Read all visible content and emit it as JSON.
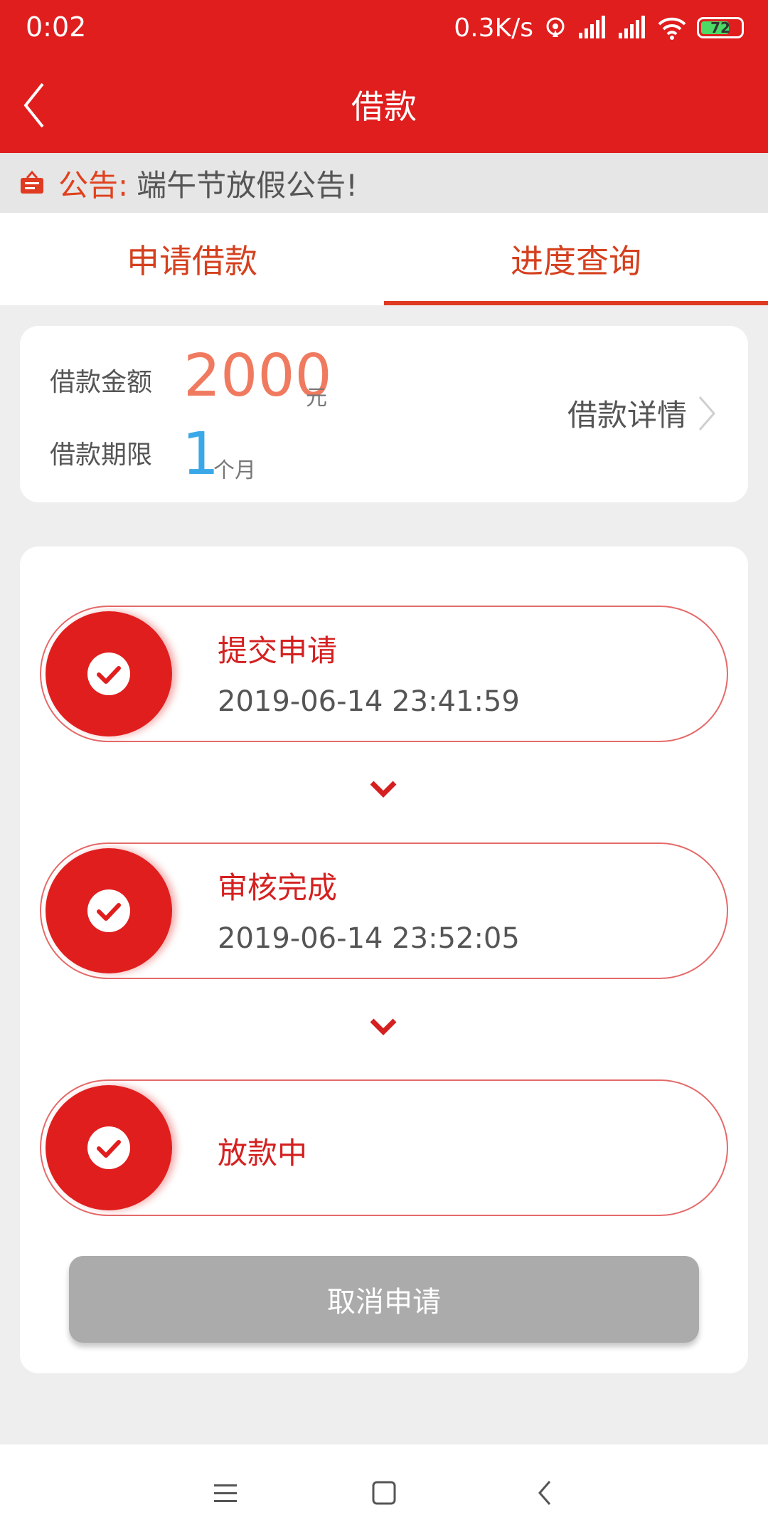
{
  "status_bar": {
    "time": "0:02",
    "net_speed": "0.3K/s",
    "battery": "72",
    "battery_level": 0.72
  },
  "app_bar": {
    "title": "借款",
    "back_icon": "chevron-left-icon"
  },
  "notice": {
    "label": "公告:",
    "text": "端午节放假公告!",
    "icon": "notice-board-icon"
  },
  "tabs": [
    {
      "label": "申请借款",
      "active": false
    },
    {
      "label": "进度查询",
      "active": true
    }
  ],
  "summary": {
    "amount_label": "借款金额",
    "amount": "2000",
    "amount_unit": "元",
    "term_label": "借款期限",
    "term": "1",
    "term_unit": "个月",
    "detail_label": "借款详情"
  },
  "steps": [
    {
      "title": "提交申请",
      "time": "2019-06-14 23:41:59"
    },
    {
      "title": "审核完成",
      "time": "2019-06-14 23:52:05"
    },
    {
      "title": "放款中",
      "time": ""
    }
  ],
  "cancel_button": "取消申请",
  "colors": {
    "brand_red": "#e01e1e",
    "amount_orange": "#f07a5f",
    "term_blue": "#3aa8e8",
    "disabled_gray": "#ababab"
  }
}
